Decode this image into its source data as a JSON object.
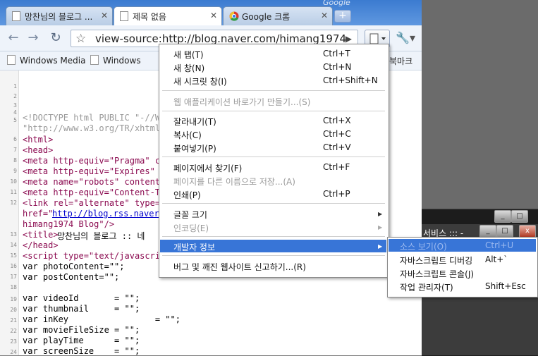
{
  "tabs": [
    {
      "label": "망찬님의 블로그 ..."
    },
    {
      "label": "제목 없음"
    },
    {
      "label": "Google 크롬"
    }
  ],
  "brand": "Google",
  "address": {
    "url": "view-source:http://blog.naver.com/himang1974"
  },
  "bookmarks": [
    {
      "label": "Windows Media"
    },
    {
      "label": "Windows"
    },
    {
      "label": "북마크"
    }
  ],
  "code": {
    "line_numbers": [
      "1",
      "2",
      "3",
      "4",
      "5",
      "",
      "6",
      "7",
      "8",
      "9",
      "10",
      "11",
      "12",
      "",
      "13",
      "14",
      "15",
      "16",
      "17",
      "18",
      "19",
      "20",
      "21",
      "22",
      "23",
      "24"
    ],
    "lines": [
      "<!DOCTYPE html PUBLIC \"-//W3",
      "\"http://www.w3.org/TR/xhtml",
      "<html>",
      "<head>",
      "<meta http-equiv=\"Pragma\" co",
      "<meta http-equiv=\"Expires\" c",
      "<meta name=\"robots\" content=",
      "<meta http-equiv=\"Content-Ty",
      "<link rel=\"alternate\" type=\"",
      "href=\"",
      "http://blog.rss.naver",
      "himang1974 Blog\"/>",
      "<title>",
      "망찬님의 블로그 :: 네",
      "</head>",
      "<script type=\"text/javascrip",
      "var photoContent=\"\";",
      "var postContent=\"\";",
      "var videoId       = \"\";",
      "var thumbnail     = \"\";",
      "var inKey                 = \"\";",
      "var movieFileSize = \"\";",
      "var playTime      = \"\";",
      "var screenSize    = \"\";"
    ]
  },
  "menu": {
    "items": [
      {
        "label": "새 탭(T)",
        "shortcut": "Ctrl+T"
      },
      {
        "label": "새 창(N)",
        "shortcut": "Ctrl+N"
      },
      {
        "label": "새 시크릿 창(I)",
        "shortcut": "Ctrl+Shift+N"
      },
      {
        "label": "웹 애플리케이션 바로가기 만들기...(S)",
        "shortcut": ""
      },
      {
        "label": "잘라내기(T)",
        "shortcut": "Ctrl+X"
      },
      {
        "label": "복사(C)",
        "shortcut": "Ctrl+C"
      },
      {
        "label": "붙여넣기(P)",
        "shortcut": "Ctrl+V"
      },
      {
        "label": "페이지에서 찾기(F)",
        "shortcut": "Ctrl+F"
      },
      {
        "label": "페이지를 다른 이름으로 저장...(A)",
        "shortcut": ""
      },
      {
        "label": "인쇄(P)",
        "shortcut": "Ctrl+P"
      },
      {
        "label": "글꼴 크기",
        "shortcut": ""
      },
      {
        "label": "인코딩(E)",
        "shortcut": ""
      },
      {
        "label": "개발자 정보",
        "shortcut": ""
      },
      {
        "label": "버그 및 깨진 웹사이트 신고하기...(R)",
        "shortcut": ""
      }
    ]
  },
  "submenu": {
    "items": [
      {
        "label": "소스 보기(O)",
        "shortcut": "Ctrl+U"
      },
      {
        "label": "자바스크립트 디버깅",
        "shortcut": "Alt+`"
      },
      {
        "label": "자바스크립트 콘솔(J)",
        "shortcut": ""
      },
      {
        "label": "작업 관리자(T)",
        "shortcut": "Shift+Esc"
      }
    ]
  },
  "background_window": {
    "title": "서비스 ::: -"
  },
  "colors": {
    "highlight": "#3875d7",
    "frame": "#5a8ed6",
    "tag": "#8b0a50"
  }
}
